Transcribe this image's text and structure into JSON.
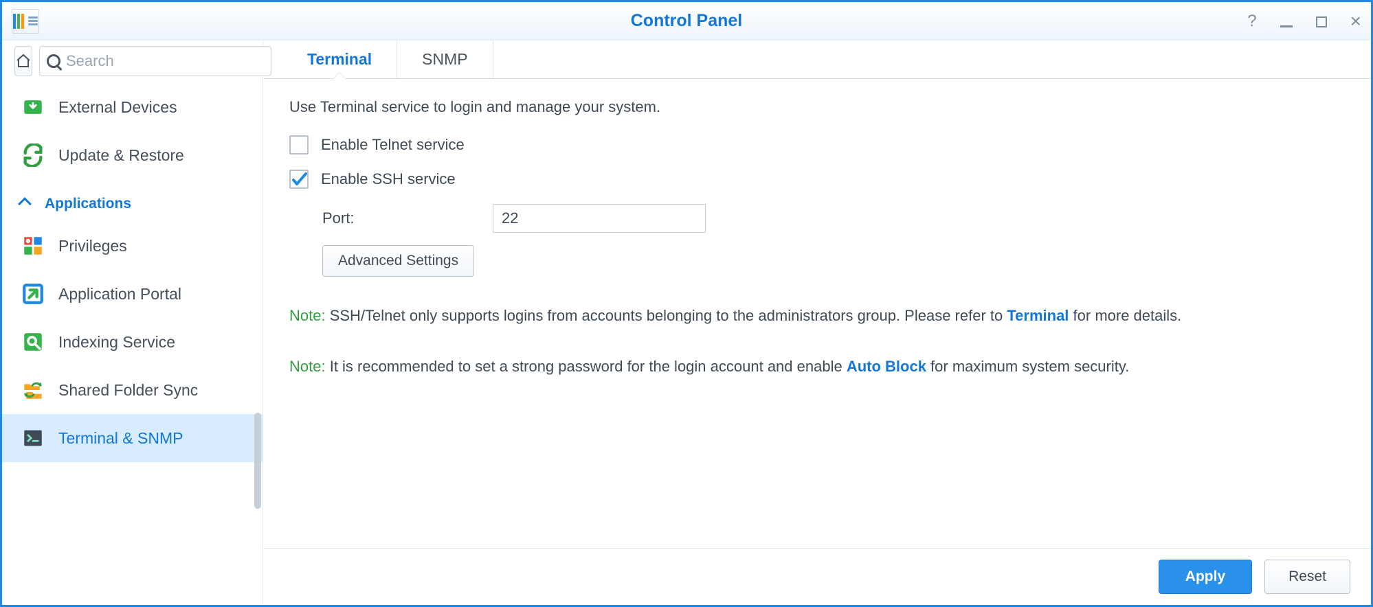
{
  "window": {
    "title": "Control Panel"
  },
  "search": {
    "placeholder": "Search"
  },
  "sidebar": {
    "items": [
      {
        "label": "External Devices"
      },
      {
        "label": "Update & Restore"
      }
    ],
    "section_header": "Applications",
    "app_items": [
      {
        "label": "Privileges"
      },
      {
        "label": "Application Portal"
      },
      {
        "label": "Indexing Service"
      },
      {
        "label": "Shared Folder Sync"
      },
      {
        "label": "Terminal & SNMP"
      }
    ]
  },
  "tabs": [
    {
      "label": "Terminal"
    },
    {
      "label": "SNMP"
    }
  ],
  "terminal": {
    "description": "Use Terminal service to login and manage your system.",
    "telnet_label": "Enable Telnet service",
    "ssh_label": "Enable SSH service",
    "port_label": "Port:",
    "port_value": "22",
    "advanced_button": "Advanced Settings",
    "note1_prefix": "Note:",
    "note1_text_a": " SSH/Telnet only supports logins from accounts belonging to the administrators group. Please refer to ",
    "note1_link": "Terminal",
    "note1_text_b": " for more details.",
    "note2_prefix": "Note:",
    "note2_text_a": " It is recommended to set a strong password for the login account and enable ",
    "note2_link": "Auto Block",
    "note2_text_b": " for maximum system security."
  },
  "footer": {
    "apply": "Apply",
    "reset": "Reset"
  }
}
